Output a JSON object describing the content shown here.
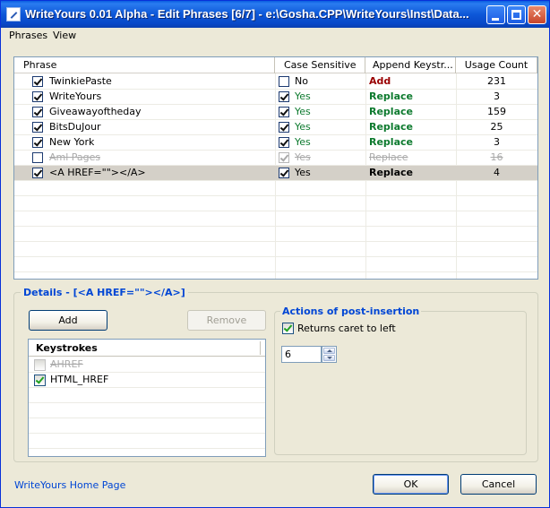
{
  "window": {
    "title": "WriteYours 0.01 Alpha - Edit Phrases [6/7] - e:\\Gosha.CPP\\WriteYours\\Inst\\Data...",
    "close_glyph": "✕"
  },
  "menu": {
    "items": [
      "Phrases",
      "View"
    ]
  },
  "grid": {
    "columns": [
      "Phrase",
      "Case Sensitive",
      "Append Keystr...",
      "Usage Count"
    ],
    "rows": [
      {
        "enabled": true,
        "phrase": "TwinkiePaste",
        "case": false,
        "case_label": "No",
        "append": "Add",
        "count": "231"
      },
      {
        "enabled": true,
        "phrase": "WriteYours",
        "case": true,
        "case_label": "Yes",
        "append": "Replace",
        "count": "3"
      },
      {
        "enabled": true,
        "phrase": "Giveawayoftheday",
        "case": true,
        "case_label": "Yes",
        "append": "Replace",
        "count": "159"
      },
      {
        "enabled": true,
        "phrase": "BitsDuJour",
        "case": true,
        "case_label": "Yes",
        "append": "Replace",
        "count": "25"
      },
      {
        "enabled": true,
        "phrase": "New York",
        "case": true,
        "case_label": "Yes",
        "append": "Replace",
        "count": "3"
      },
      {
        "enabled": false,
        "phrase": "Aml Pages",
        "case": true,
        "case_label": "Yes",
        "append": "Replace",
        "count": "16"
      },
      {
        "enabled": true,
        "phrase": "<A HREF=\"\"></A>",
        "case": true,
        "case_label": "Yes",
        "append": "Replace",
        "count": "4",
        "selected": true
      }
    ]
  },
  "details": {
    "title": "Details - [<A HREF=\"\"></A>]",
    "add_label": "Add",
    "remove_label": "Remove",
    "keystrokes_header": "Keystrokes",
    "keystrokes": [
      {
        "label": "AHREF",
        "checked": false,
        "enabled": false
      },
      {
        "label": "HTML_HREF",
        "checked": true,
        "enabled": true
      }
    ],
    "actions_title": "Actions of post-insertion",
    "returns_caret_label": "Returns caret to left",
    "returns_caret_checked": true,
    "caret_value": "6"
  },
  "footer": {
    "home_link": "WriteYours Home Page",
    "ok_label": "OK",
    "cancel_label": "Cancel"
  }
}
